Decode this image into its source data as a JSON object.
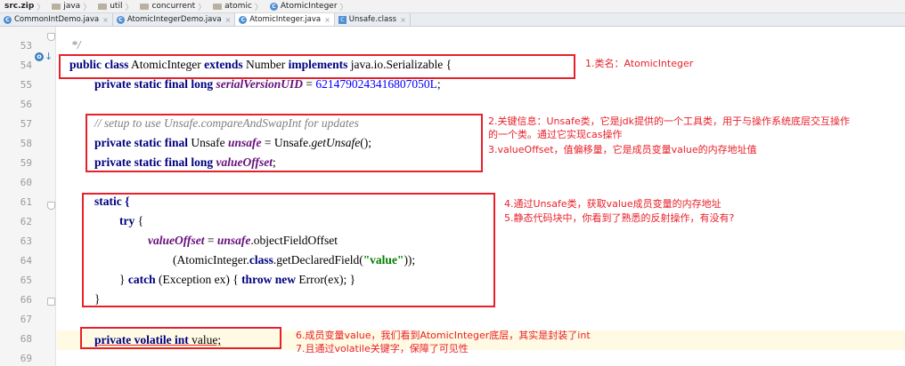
{
  "breadcrumb": [
    "src.zip",
    "java",
    "util",
    "concurrent",
    "atomic",
    "AtomicInteger"
  ],
  "tabs": [
    {
      "label": "CommonIntDemo.java",
      "active": false
    },
    {
      "label": "AtomicIntegerDemo.java",
      "active": false
    },
    {
      "label": "AtomicInteger.java",
      "active": true
    },
    {
      "label": "Unsafe.class",
      "active": false
    }
  ],
  "line_numbers": [
    "53",
    "54",
    "55",
    "56",
    "57",
    "58",
    "59",
    "60",
    "61",
    "62",
    "63",
    "64",
    "65",
    "66",
    "67",
    "68",
    "69"
  ],
  "code": {
    "l53": "*/",
    "l54_kw1": "public class",
    "l54_name": " AtomicInteger ",
    "l54_kw2": "extends",
    "l54_num": " Number ",
    "l54_kw3": "implements",
    "l54_rest": " java.io.Serializable {",
    "l55_kw": "private static final long",
    "l55_field": "serialVersionUID",
    "l55_eq": " = ",
    "l55_num": "6214790243416807050L",
    "l55_end": ";",
    "l57": "// setup to use Unsafe.compareAndSwapInt for updates",
    "l58_kw": "private static final",
    "l58_type": " Unsafe ",
    "l58_field": "unsafe",
    "l58_rest": " = Unsafe.",
    "l58_it": "getUnsafe",
    "l58_end": "();",
    "l59_kw": "private static final long",
    "l59_field": "valueOffset",
    "l59_end": ";",
    "l61": "static {",
    "l62_kw": "try",
    "l62_end": " {",
    "l63_field1": "valueOffset",
    "l63_eq": " = ",
    "l63_field2": "unsafe",
    "l63_rest": ".objectFieldOffset",
    "l64_pre": "(AtomicInteger.",
    "l64_kw": "class",
    "l64_mid": ".getDeclaredField(",
    "l64_str": "\"value\"",
    "l64_end": "));",
    "l65_pre": "} ",
    "l65_kw1": "catch",
    "l65_mid": " (Exception ex) { ",
    "l65_kw2": "throw new",
    "l65_end": " Error(ex); }",
    "l66": "}",
    "l68_kw": "private volatile int",
    "l68_name": " value;"
  },
  "annotations": {
    "n1": "1.类名：AtomicInteger",
    "n2a": "2.关键信息：Unsafe类，它是jdk提供的一个工具类，用于与操作系统底层交互操作",
    "n2b": "的一个类。通过它实现cas操作",
    "n3": "3.valueOffset，值偏移量，它是成员变量value的内存地址值",
    "n4": "4.通过Unsafe类，获取value成员变量的内存地址",
    "n5": "5.静态代码块中，你看到了熟悉的反射操作，有没有?",
    "n6": "6.成员变量value，我们看到AtomicInteger底层，其实是封装了int",
    "n7": "7.且通过volatile关键字，保障了可见性"
  },
  "colors": {
    "annotation": "#e8202a",
    "keyword": "#000080",
    "field": "#660e7a",
    "string": "#008000",
    "number": "#0000ff"
  }
}
